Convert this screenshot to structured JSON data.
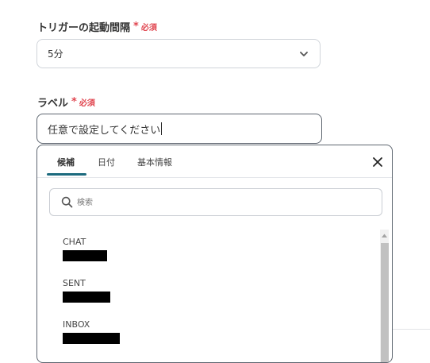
{
  "trigger_interval": {
    "label": "トリガーの起動間隔",
    "required_mark": "*",
    "required_text": "必須",
    "selected_value": "5分"
  },
  "label_field": {
    "label": "ラベル",
    "required_mark": "*",
    "required_text": "必須",
    "value": "任意で設定してください"
  },
  "picker": {
    "tabs": [
      {
        "label": "候補",
        "active": true
      },
      {
        "label": "日付",
        "active": false
      },
      {
        "label": "基本情報",
        "active": false
      }
    ],
    "search_placeholder": "検索",
    "items": [
      {
        "name": "CHAT",
        "value_redacted": true
      },
      {
        "name": "SENT",
        "value_redacted": true
      },
      {
        "name": "INBOX",
        "value_redacted": true
      }
    ]
  },
  "colors": {
    "required": "#e0454f",
    "tab_underline": "#1c6a7e",
    "border": "#5e6670"
  },
  "icons": [
    "chevron-down-icon",
    "close-icon",
    "search-icon",
    "scroll-up-arrow-icon"
  ]
}
